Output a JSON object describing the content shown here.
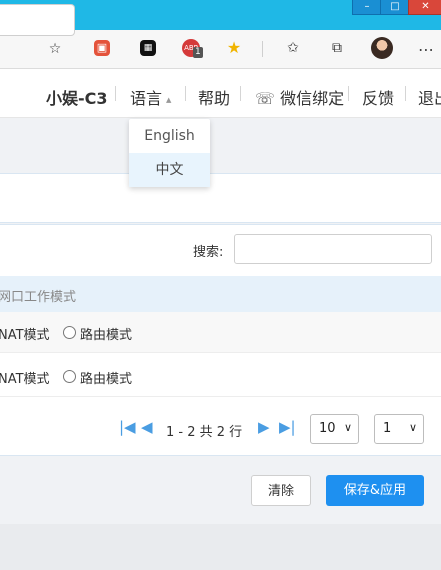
{
  "window": {
    "controls": {
      "minimize": "–",
      "maximize": "□",
      "close": "✕"
    }
  },
  "browser": {
    "icons": [
      "favorite-add-icon",
      "extension-red-icon",
      "extension-tab-icon",
      "adblock-icon",
      "extension-yellow-icon",
      "favorites-icon",
      "collections-icon",
      "profile-avatar",
      "more-icon"
    ],
    "adblock_count": "1"
  },
  "header": {
    "device_name": "小娱-C3",
    "language_label": "语言",
    "help_label": "帮助",
    "wechat_label": "微信绑定",
    "feedback_label": "反馈",
    "logout_label": "退出"
  },
  "language_dropdown": {
    "options": [
      {
        "label": "English",
        "selected": false
      },
      {
        "label": "中文",
        "selected": true
      }
    ]
  },
  "table": {
    "search_label": "搜索:",
    "search_value": "",
    "column_header": "网口工作模式",
    "rows": [
      {
        "nat_label": "NAT模式",
        "route_label": "路由模式"
      },
      {
        "nat_label": "NAT模式",
        "route_label": "路由模式"
      }
    ],
    "pagination": {
      "range_text": "1 - 2 共 2 行",
      "page_size": "10",
      "page_number": "1"
    }
  },
  "actions": {
    "clear_label": "清除",
    "save_label": "保存&应用"
  },
  "colors": {
    "titlebar": "#1fb8e6",
    "primary_button": "#1e90f0",
    "header_row_bg": "#e6f1fa",
    "dropdown_selected_bg": "#e8f4fd",
    "pagination_icon": "#4a9de2"
  }
}
